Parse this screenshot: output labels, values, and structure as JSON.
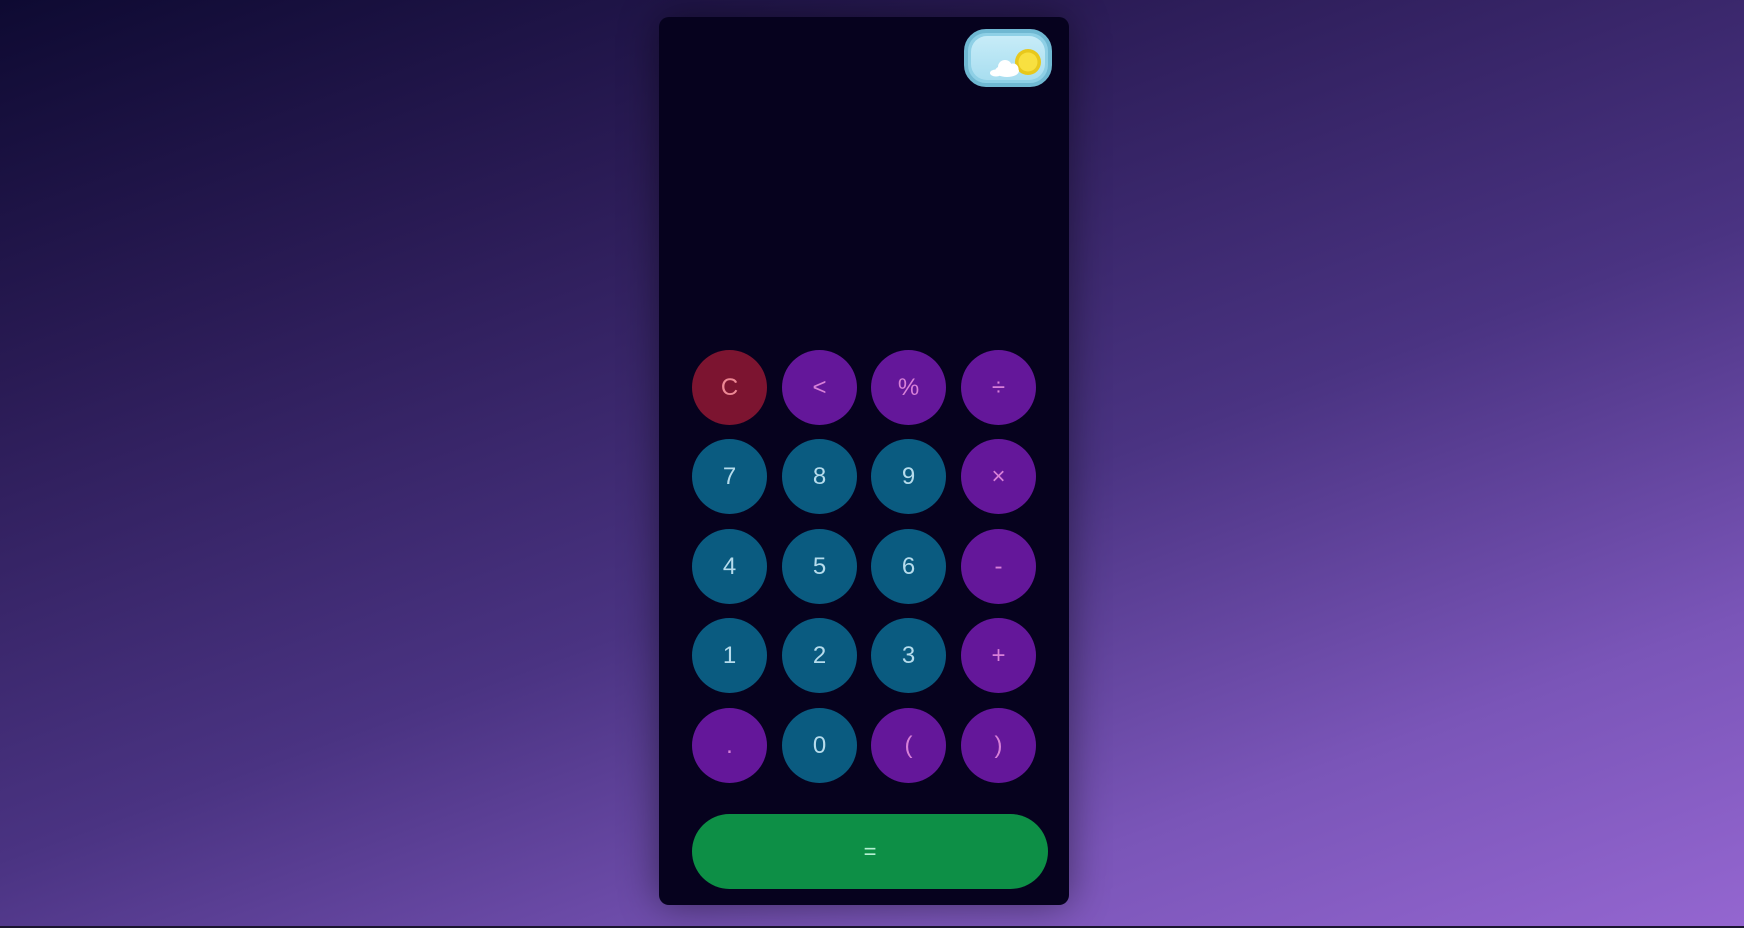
{
  "display": {
    "expression": ""
  },
  "theme_toggle": {
    "icon": "sun-cloud-icon",
    "colors": {
      "track": "#8ed0e6",
      "sun": "#f5d020",
      "cloud": "#ffffff"
    }
  },
  "keys": {
    "clear": "C",
    "backspace": "<",
    "percent": "%",
    "divide": "÷",
    "seven": "7",
    "eight": "8",
    "nine": "9",
    "multiply": "×",
    "four": "4",
    "five": "5",
    "six": "6",
    "subtract": "-",
    "one": "1",
    "two": "2",
    "three": "3",
    "add": "+",
    "decimal": ".",
    "zero": "0",
    "open_paren": "(",
    "close_paren": ")",
    "equals": "="
  },
  "colors": {
    "number_key": "#0a5b80",
    "operator_key": "#64179a",
    "clear_key": "#7c1430",
    "equals_key": "#0d8f46",
    "panel": "#06021e"
  }
}
